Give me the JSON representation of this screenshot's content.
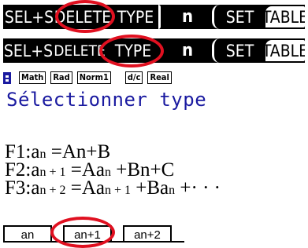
{
  "top_menu": {
    "keys": [
      "SEL+S",
      "DELETE",
      "TYPE",
      "n",
      "SET",
      "TABLE"
    ]
  },
  "second_menu": {
    "keys": [
      "SEL+S",
      "DELETE",
      "TYPE",
      "n",
      "SET",
      "TABLE"
    ]
  },
  "status_bar": {
    "modes": [
      "Math",
      "Rad",
      "Norm1",
      "d/c",
      "Real"
    ]
  },
  "screen": {
    "title": "Sélectionner type",
    "lines": [
      {
        "key": "F1:",
        "a": "a",
        "sub": "n",
        "rest": " =An+B"
      },
      {
        "key": "F2:",
        "a": "a",
        "sub": "n + 1",
        "rest": " =Aa",
        "sub2": "n",
        "rest2": " +Bn+C"
      },
      {
        "key": "F3:",
        "a": "a",
        "sub": "n + 2",
        "rest": " =Aa",
        "sub2": "n + 1",
        "rest2": " +Ba",
        "sub3": "n",
        "rest3": " +· · ·"
      }
    ]
  },
  "soft_keys": {
    "items": [
      "an",
      "an+1",
      "an+2"
    ]
  },
  "highlight_color": "#e01020",
  "accent_color": "#1a1aa0"
}
